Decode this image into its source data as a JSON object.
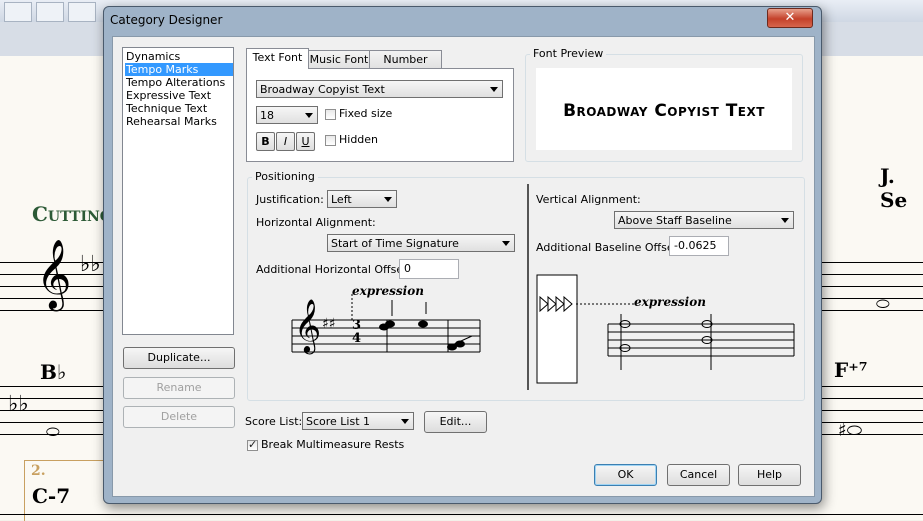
{
  "dialog": {
    "title": "Category Designer",
    "close_label": "✕"
  },
  "categories": {
    "items": [
      "Dynamics",
      "Tempo Marks",
      "Tempo Alterations",
      "Expressive Text",
      "Technique Text",
      "Rehearsal Marks"
    ],
    "selected_index": 1
  },
  "category_buttons": {
    "duplicate": "Duplicate...",
    "rename": "Rename",
    "delete": "Delete"
  },
  "tabs": [
    "Text Font",
    "Music Font",
    "Number Font"
  ],
  "active_tab": "Text Font",
  "font": {
    "name": "Broadway Copyist Text",
    "size": "18",
    "fixed_size_label": "Fixed size",
    "fixed_size_checked": false,
    "bold_label": "B",
    "italic_label": "I",
    "underline_label": "U",
    "hidden_label": "Hidden",
    "hidden_checked": false
  },
  "font_preview": {
    "label": "Font Preview",
    "text": "Broadway Copyist Text"
  },
  "positioning": {
    "label": "Positioning",
    "justification_label": "Justification:",
    "justification_value": "Left",
    "horizontal_alignment_label": "Horizontal Alignment:",
    "horizontal_alignment_value": "Start of Time Signature",
    "horizontal_offset_label": "Additional Horizontal Offset:",
    "horizontal_offset_value": "0",
    "vertical_alignment_label": "Vertical Alignment:",
    "vertical_alignment_value": "Above Staff Baseline",
    "baseline_offset_label": "Additional Baseline Offset:",
    "baseline_offset_value": "-0.0625",
    "example_text": "expression",
    "example_text_right": "expression",
    "time_signature_top": "3",
    "time_signature_bottom": "4"
  },
  "score_list": {
    "label": "Score List:",
    "value": "Score List 1",
    "edit_label": "Edit..."
  },
  "break_rests": {
    "label": "Break Multimeasure Rests",
    "checked": true
  },
  "footer": {
    "ok": "OK",
    "cancel": "Cancel",
    "help": "Help"
  },
  "background_score": {
    "title_left": "Cutting",
    "composer_right": "J. Se",
    "chord_bb": "B♭",
    "chord_f7": "F⁺⁷",
    "chord_c7": "C-7",
    "rehearsal": "2."
  }
}
